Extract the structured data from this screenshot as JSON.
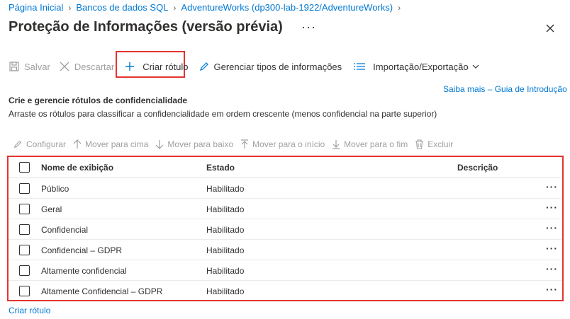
{
  "breadcrumb": [
    {
      "label": "Página Inicial"
    },
    {
      "label": "Bancos de dados SQL"
    },
    {
      "label": "AdventureWorks (dp300-lab-1922/AdventureWorks)"
    }
  ],
  "page_title": "Proteção de Informações (versão prévia)",
  "title_more": "···",
  "toolbar": {
    "save_label": "Salvar",
    "discard_label": "Descartar",
    "create_label": "Criar rótulo",
    "manage_label": "Gerenciar tipos de informações",
    "import_export_label": "Importação/Exportação"
  },
  "learn_more": "Saiba mais – Guia de Introdução",
  "section": {
    "title": "Crie e gerencie rótulos de confidencialidade",
    "description": "Arraste os rótulos para classificar a confidencialidade em ordem crescente (menos confidencial na parte superior)"
  },
  "toolbar2": {
    "configure": "Configurar",
    "move_up": "Mover para cima",
    "move_down": "Mover para baixo",
    "move_top": "Mover para o início",
    "move_bottom": "Mover para o fim",
    "delete": "Excluir"
  },
  "table": {
    "headers": {
      "name": "Nome de exibição",
      "state": "Estado",
      "description": "Descrição"
    },
    "rows": [
      {
        "name": "Público",
        "state": "Habilitado",
        "description": ""
      },
      {
        "name": "Geral",
        "state": "Habilitado",
        "description": ""
      },
      {
        "name": "Confidencial",
        "state": "Habilitado",
        "description": ""
      },
      {
        "name": "Confidencial – GDPR",
        "state": "Habilitado",
        "description": ""
      },
      {
        "name": "Altamente confidencial",
        "state": "Habilitado",
        "description": ""
      },
      {
        "name": "Altamente Confidencial – GDPR",
        "state": "Habilitado",
        "description": ""
      }
    ],
    "row_more": "···"
  },
  "create_link": "Criar rótulo",
  "colors": {
    "accent": "#0078d4",
    "highlight": "#e3342f",
    "disabled": "#a19f9d",
    "text": "#323130"
  }
}
